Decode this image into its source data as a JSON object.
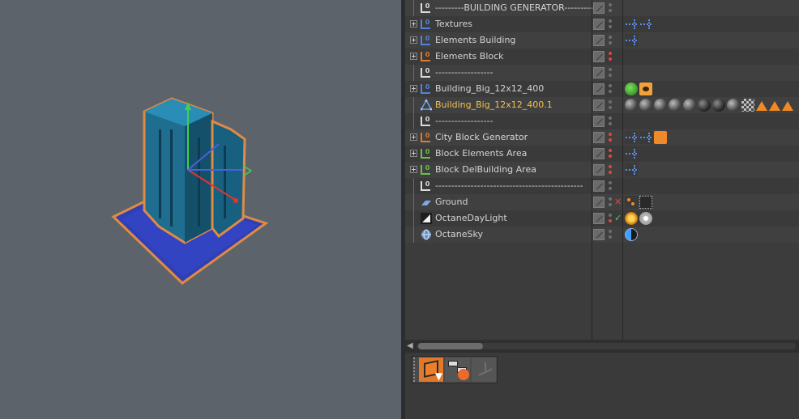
{
  "viewport": {
    "label": "3D viewport",
    "bg": "#5c636b",
    "accent_selection": "#e08a45"
  },
  "object_manager": {
    "rows": [
      {
        "name": "---------BUILDING GENERATOR---------",
        "icon": "null-icon",
        "color": "white",
        "expander": false,
        "dots": [
          "grey",
          "grey"
        ],
        "mark": "",
        "tags": []
      },
      {
        "name": "Textures",
        "icon": "null-icon",
        "color": "blue",
        "expander": true,
        "dots": [
          "grey",
          "grey"
        ],
        "mark": "",
        "tags": [
          "xp",
          "xp"
        ]
      },
      {
        "name": "Elements Building",
        "icon": "null-icon",
        "color": "blue",
        "expander": true,
        "dots": [
          "grey",
          "grey"
        ],
        "mark": "",
        "tags": [
          "xp"
        ]
      },
      {
        "name": "Elements Block",
        "icon": "null-icon",
        "color": "orange",
        "expander": true,
        "dots": [
          "red",
          "red"
        ],
        "mark": "",
        "tags": []
      },
      {
        "name": "------------------",
        "icon": "null-icon",
        "color": "white",
        "expander": false,
        "dots": [
          "grey",
          "grey"
        ],
        "mark": "",
        "tags": []
      },
      {
        "name": "Building_Big_12x12_400",
        "icon": "null-icon",
        "color": "blue",
        "expander": true,
        "dots": [
          "grey",
          "grey"
        ],
        "mark": "",
        "tags": [
          "green",
          "eye"
        ]
      },
      {
        "name": "Building_Big_12x12_400.1",
        "icon": "poly-icon",
        "color": "blue",
        "expander": false,
        "selected": true,
        "dots": [
          "grey",
          "grey"
        ],
        "mark": "",
        "tags": [
          "mat",
          "mat",
          "mat",
          "mat",
          "mat",
          "dark",
          "dark",
          "mat",
          "check",
          "tri",
          "tri",
          "tri"
        ]
      },
      {
        "name": "------------------",
        "icon": "null-icon",
        "color": "white",
        "expander": false,
        "dots": [
          "grey",
          "grey"
        ],
        "mark": "",
        "tags": []
      },
      {
        "name": "City Block Generator",
        "icon": "null-icon",
        "color": "orange",
        "expander": true,
        "dots": [
          "red",
          "red"
        ],
        "mark": "",
        "tags": [
          "xp",
          "xp",
          "orange"
        ]
      },
      {
        "name": "Block Elements Area",
        "icon": "null-icon",
        "color": "green",
        "expander": true,
        "dots": [
          "red",
          "red"
        ],
        "mark": "",
        "tags": [
          "xp"
        ]
      },
      {
        "name": "Block DelBuilding Area",
        "icon": "null-icon",
        "color": "green",
        "expander": true,
        "dots": [
          "red",
          "red"
        ],
        "mark": "",
        "tags": [
          "xp"
        ]
      },
      {
        "name": "----------------------------------------------",
        "icon": "null-icon",
        "color": "white",
        "expander": false,
        "dots": [
          "grey",
          "grey"
        ],
        "mark": "",
        "tags": []
      },
      {
        "name": "Ground",
        "icon": "plane-icon",
        "color": "blue",
        "expander": false,
        "dots": [
          "grey",
          "grey"
        ],
        "mark": "✕",
        "mark_color": "#e2453d",
        "tags": [
          "pts",
          "box"
        ]
      },
      {
        "name": "OctaneDayLight",
        "icon": "daylight-icon",
        "color": "white",
        "expander": false,
        "dots": [
          "grey",
          "red"
        ],
        "mark": "✓",
        "mark_color": "#5fd06a",
        "tags": [
          "sun",
          "gear"
        ]
      },
      {
        "name": "OctaneSky",
        "icon": "sky-icon",
        "color": "blue",
        "expander": false,
        "dots": [
          "grey",
          "grey"
        ],
        "mark": "",
        "tags": [
          "sky"
        ]
      }
    ]
  },
  "scrollbar": {
    "arrow": "◀"
  },
  "palette": {
    "buttons": [
      {
        "name": "model-mode-button",
        "active": true
      },
      {
        "name": "hierarchy-mode-button",
        "active": false
      },
      {
        "name": "axis-mode-button",
        "active": false
      }
    ]
  }
}
